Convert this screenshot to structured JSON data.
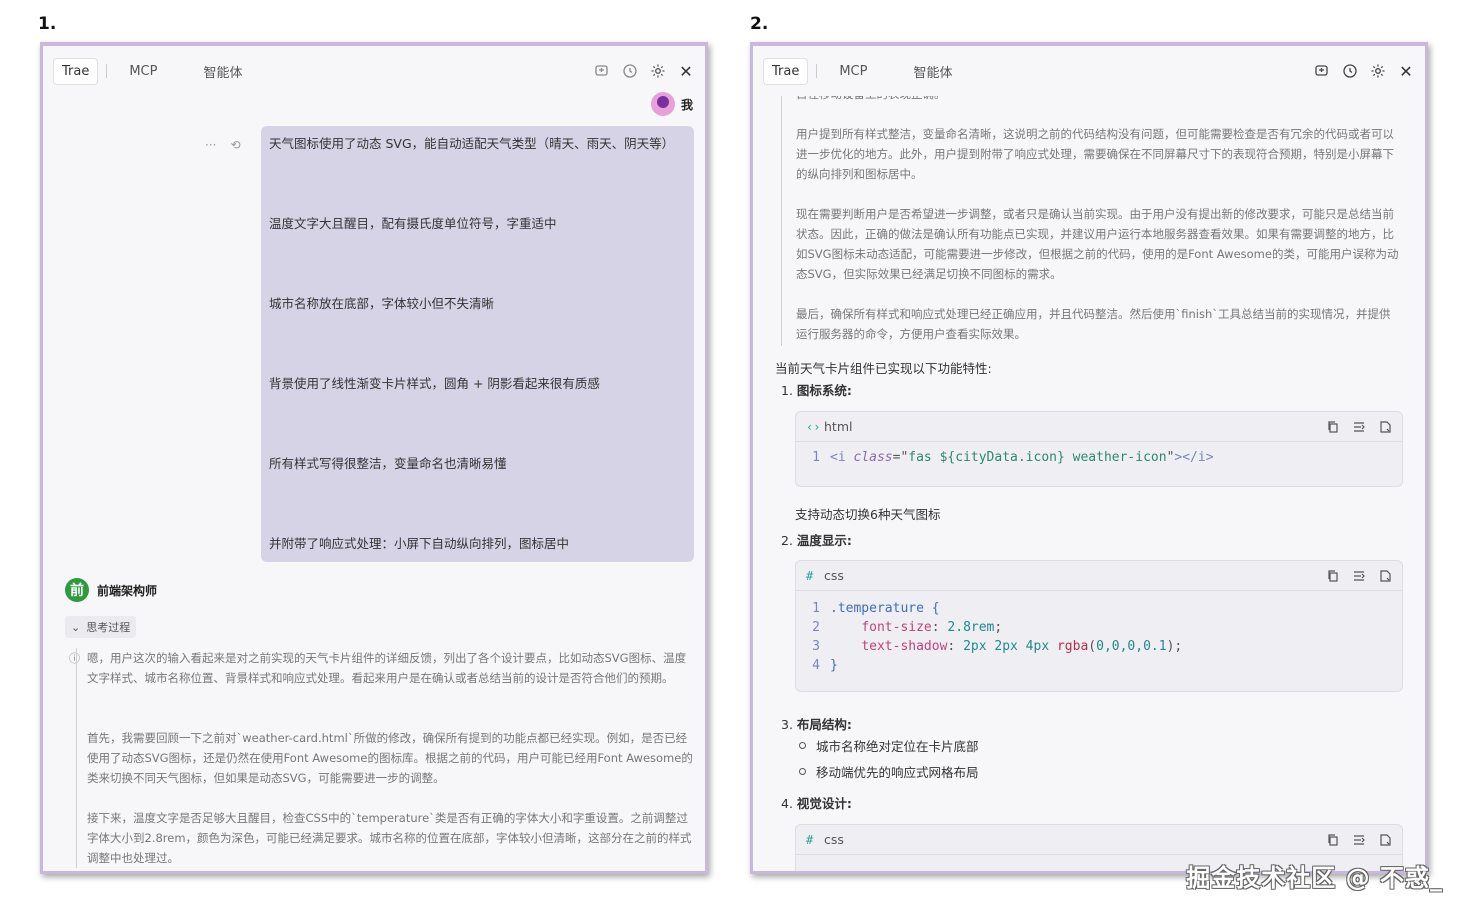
{
  "labels": {
    "step1": "1.",
    "step2": "2."
  },
  "tabs": {
    "trae": "Trae",
    "mcp": "MCP",
    "agent": "智能体"
  },
  "icons": {
    "new_chat": "new-chat-icon",
    "history": "history-icon",
    "settings": "gear-icon",
    "close": "close-icon",
    "more": "more-icon",
    "retry": "retry-icon"
  },
  "panel1": {
    "user_name": "我",
    "user_message": [
      "天气图标使用了动态 SVG，能自动适配天气类型（晴天、雨天、阴天等）",
      "温度文字大且醒目，配有摄氏度单位符号，字重适中",
      "城市名称放在底部，字体较小但不失清晰",
      "背景使用了线性渐变卡片样式，圆角 + 阴影看起来很有质感",
      "所有样式写得很整洁，变量命名也清晰易懂",
      "并附带了响应式处理：小屏下自动纵向排列，图标居中"
    ],
    "agent_avatar_char": "前",
    "agent_name": "前端架构师",
    "think_label": "思考过程",
    "think_paragraphs": [
      "嗯，用户这次的输入看起来是对之前实现的天气卡片组件的详细反馈，列出了各个设计要点，比如动态SVG图标、温度文字样式、城市名称位置、背景样式和响应式处理。看起来用户是在确认或者总结当前的设计是否符合他们的预期。",
      "首先，我需要回顾一下之前对`weather-card.html`所做的修改，确保所有提到的功能点都已经实现。例如，是否已经使用了动态SVG图标，还是仍然在使用Font Awesome的图标库。根据之前的代码，用户可能已经用Font Awesome的类来切换不同天气图标，但如果是动态SVG，可能需要进一步的调整。",
      "接下来，温度文字是否足够大且醒目，检查CSS中的`temperature`类是否有正确的字体大小和字重设置。之前调整过字体大小到2.8rem，颜色为深色，可能已经满足要求。城市名称的位置在底部，字体较小但清晰，这部分在之前的样式调整中也处理过。"
    ]
  },
  "panel2": {
    "cut_line": "目在移动设备上的表现正确。",
    "think_paragraphs": [
      "用户提到所有样式整洁，变量命名清晰，这说明之前的代码结构没有问题，但可能需要检查是否有冗余的代码或者可以进一步优化的地方。此外，用户提到附带了响应式处理，需要确保在不同屏幕尺寸下的表现符合预期，特别是小屏幕下的纵向排列和图标居中。",
      "现在需要判断用户是否希望进一步调整，或者只是确认当前实现。由于用户没有提出新的修改要求，可能只是总结当前状态。因此，正确的做法是确认所有功能点已实现，并建议用户运行本地服务器查看效果。如果有需要调整的地方，比如SVG图标未动态适配，可能需要进一步修改，但根据之前的代码，使用的是Font Awesome的类，可能用户误称为动态SVG，但实际效果已经满足切换不同图标的需求。",
      "最后，确保所有样式和响应式处理已经正确应用，并且代码整洁。然后使用`finish`工具总结当前的实现情况，并提供运行服务器的命令，方便用户查看实际效果。"
    ],
    "intro": "当前天气卡片组件已实现以下功能特性:",
    "sections": [
      {
        "num": "1.",
        "title": "图标系统:"
      },
      {
        "num": "2.",
        "title": "温度显示:"
      },
      {
        "num": "3.",
        "title": "布局结构:"
      },
      {
        "num": "4.",
        "title": "视觉设计:"
      }
    ],
    "code_html": {
      "lang": "html",
      "lines": [
        {
          "n": "1",
          "tokens": [
            [
              "tag",
              "<i "
            ],
            [
              "attr",
              "class"
            ],
            [
              "punc",
              "=\""
            ],
            [
              "str",
              "fas ${cityData.icon} weather-icon"
            ],
            [
              "punc",
              "\""
            ],
            [
              "tag",
              "></i>"
            ]
          ]
        }
      ]
    },
    "icon_note": "支持动态切换6种天气图标",
    "code_css1": {
      "lang": "css",
      "lines": [
        {
          "n": "1",
          "tokens": [
            [
              "sel",
              ".temperature {"
            ]
          ]
        },
        {
          "n": "2",
          "tokens": [
            [
              "punc",
              "    "
            ],
            [
              "prop",
              "font-size"
            ],
            [
              "punc",
              ": "
            ],
            [
              "num",
              "2.8rem"
            ],
            [
              "punc",
              ";"
            ]
          ]
        },
        {
          "n": "3",
          "tokens": [
            [
              "punc",
              "    "
            ],
            [
              "prop",
              "text-shadow"
            ],
            [
              "punc",
              ": "
            ],
            [
              "num",
              "2px 2px 4px "
            ],
            [
              "fn",
              "rgba"
            ],
            [
              "punc",
              "("
            ],
            [
              "num",
              "0,0,0,0.1"
            ],
            [
              "punc",
              ");"
            ]
          ]
        },
        {
          "n": "4",
          "tokens": [
            [
              "sel",
              "}"
            ]
          ]
        }
      ]
    },
    "layout_bullets": [
      "城市名称绝对定位在卡片底部",
      "移动端优先的响应式网格布局"
    ],
    "code_css2": {
      "lang": "css"
    }
  },
  "watermark": "掘金技术社区 @ 不惑_"
}
